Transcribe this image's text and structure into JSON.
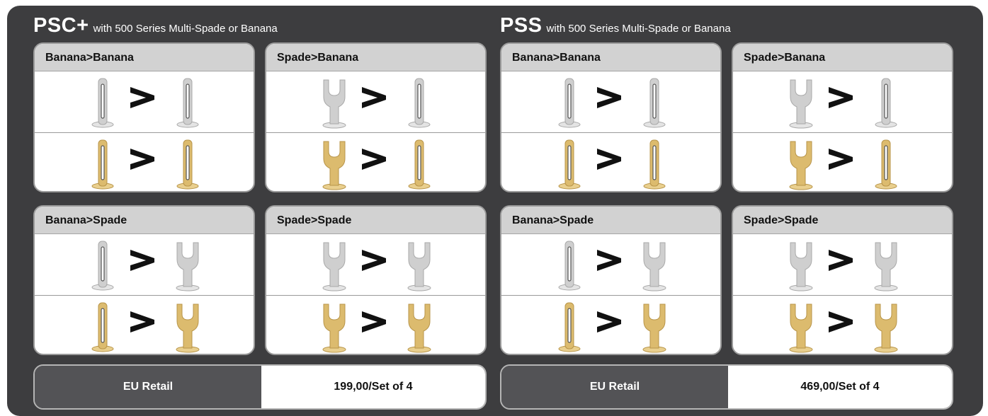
{
  "sections": [
    {
      "title": "PSC+",
      "subtitle": "with 500 Series Multi-Spade or Banana",
      "cards": [
        {
          "title": "Banana>Banana",
          "from": "banana",
          "to": "banana"
        },
        {
          "title": "Spade>Banana",
          "from": "spade",
          "to": "banana"
        },
        {
          "title": "Banana>Spade",
          "from": "banana",
          "to": "spade"
        },
        {
          "title": "Spade>Spade",
          "from": "spade",
          "to": "spade"
        }
      ],
      "price_label": "EU Retail",
      "price_value": "199,00/Set of 4"
    },
    {
      "title": "PSS",
      "subtitle": "with 500 Series Multi-Spade or Banana",
      "cards": [
        {
          "title": "Banana>Banana",
          "from": "banana",
          "to": "banana"
        },
        {
          "title": "Spade>Banana",
          "from": "spade",
          "to": "banana"
        },
        {
          "title": "Banana>Spade",
          "from": "banana",
          "to": "spade"
        },
        {
          "title": "Spade>Spade",
          "from": "spade",
          "to": "spade"
        }
      ],
      "price_label": "EU Retail",
      "price_value": "469,00/Set of 4"
    }
  ],
  "finishes": [
    {
      "name": "silver",
      "fill": "#cfcfcf",
      "dark": "#a9a9a9",
      "base": "#e4e4e4"
    },
    {
      "name": "gold",
      "fill": "#dcbb6e",
      "dark": "#b8954a",
      "base": "#e9cf8e"
    }
  ],
  "colors": {
    "panel": "#3d3d3f",
    "card_header": "#d2d2d2",
    "price_label_bg": "#535356"
  }
}
